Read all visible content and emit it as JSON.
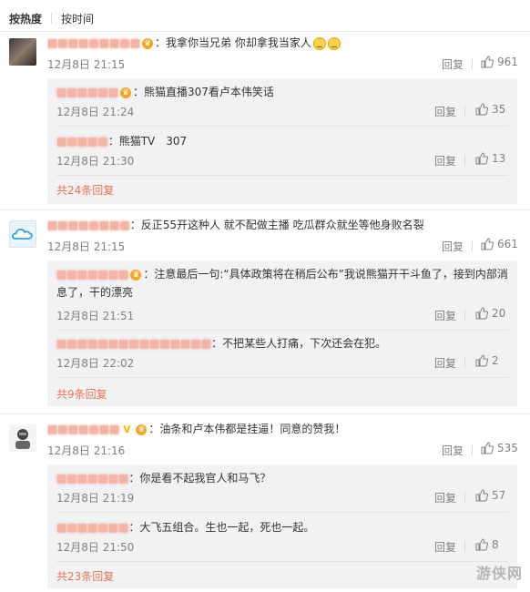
{
  "tabs": {
    "hot": "按热度",
    "time": "按时间"
  },
  "comments": [
    {
      "user": "■■■■■■■■■",
      "text": "：我拿你当兄弟 你却拿我当家人",
      "time": "12月8日 21:15",
      "reply": "回复",
      "likes": "961",
      "subs": [
        {
          "user": "■■■■■■",
          "text": "：熊猫直播307看卢本伟笑话",
          "time": "12月8日 21:24",
          "reply": "回复",
          "likes": "35"
        },
        {
          "user": "■■■■■",
          "text": "：熊猫TV　307",
          "time": "12月8日 21:30",
          "reply": "回复",
          "likes": "13"
        }
      ],
      "more": "共24条回复"
    },
    {
      "user": "■■■■■■■■",
      "text": "：反正55开这种人 就不配做主播  吃瓜群众就坐等他身败名裂",
      "time": "12月8日 21:15",
      "reply": "回复",
      "likes": "661",
      "subs": [
        {
          "user": "■■■■■■■",
          "text": "：注意最后一句:“具体政策将在稍后公布”我说熊猫开干斗鱼了，接到内部消",
          "text2": "息了，干的漂亮",
          "time": "12月8日 21:51",
          "reply": "回复",
          "likes": "20"
        },
        {
          "user": "■■■■■■■■■■■■■■■",
          "text": "：不把某些人打痛，下次还会在犯。",
          "time": "12月8日 22:02",
          "reply": "回复",
          "likes": "2"
        }
      ],
      "more": "共9条回复"
    },
    {
      "user": "■■■■■■■",
      "text": "：油条和卢本伟都是挂逼！同意的赞我！",
      "time": "12月8日 21:16",
      "reply": "回复",
      "likes": "535",
      "subs": [
        {
          "user": "■■■■■■■",
          "text": "：你是看不起我官人和马飞？",
          "time": "12月8日 21:19",
          "reply": "回复",
          "likes": "57"
        },
        {
          "user": "■■■■■■■",
          "text": "：大飞五组合。生也一起，死也一起。",
          "time": "12月8日 21:50",
          "reply": "回复",
          "likes": "8"
        }
      ],
      "more": "共23条回复"
    }
  ],
  "watermark": "游侠网",
  "colors": {
    "accent": "#eb7350",
    "subBg": "#f2f2f5",
    "meta": "#808080"
  },
  "icons": {
    "like": "thumbs-up-icon",
    "vip": "vip-crown-icon",
    "emoji": "crying-emoji-icon"
  }
}
